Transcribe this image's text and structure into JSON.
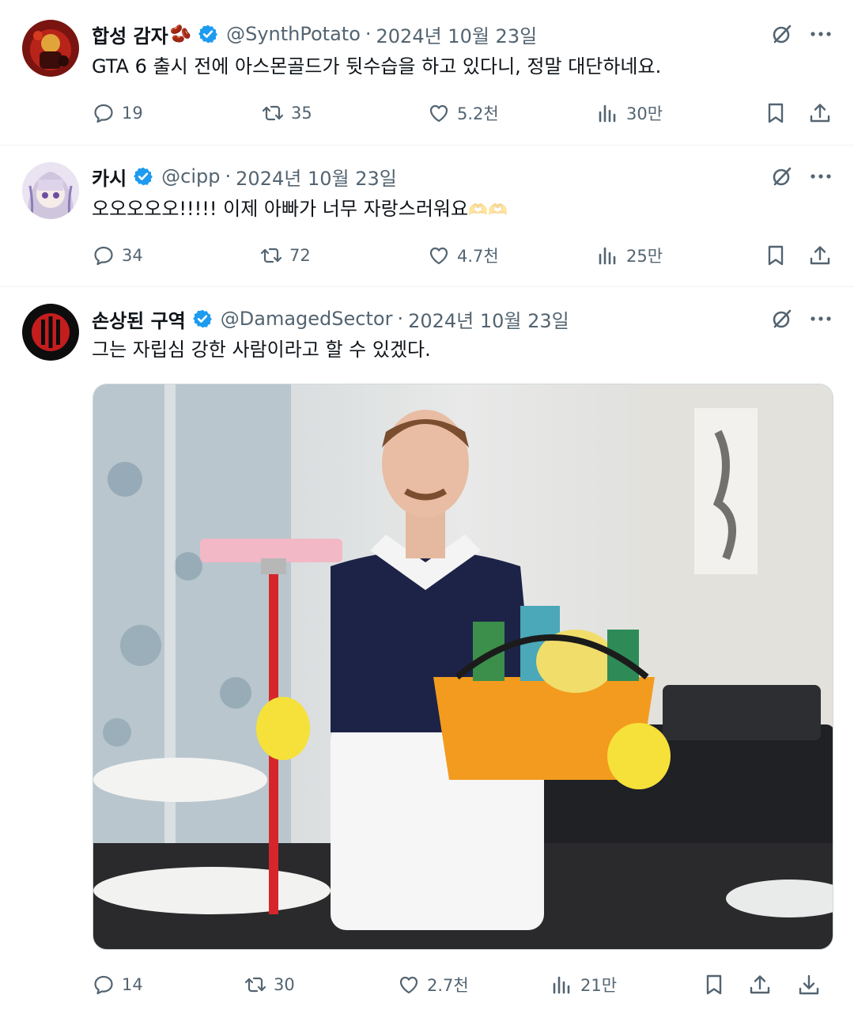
{
  "colors": {
    "text": "#0f1419",
    "muted": "#536471",
    "verified": "#1d9bf0",
    "divider": "#eff3f4"
  },
  "tweets": [
    {
      "name": "합성 감자",
      "name_emoji": "🫘",
      "handle": "@SynthPotato",
      "date": "2024년 10월 23일",
      "text": "GTA 6 출시 전에 아스몬골드가 뒷수습을 하고 있다니, 정말 대단하네요.",
      "replies": "19",
      "reposts": "35",
      "likes": "5.2천",
      "views": "30만"
    },
    {
      "name": "카시",
      "handle": "@cipp",
      "date": "2024년 10월 23일",
      "text": "오오오오오!!!!! 이제 아빠가 너무 자랑스러워요",
      "text_emoji": "🫶🫶",
      "replies": "34",
      "reposts": "72",
      "likes": "4.7천",
      "views": "25만"
    },
    {
      "name": "손상된 구역",
      "handle": "@DamagedSector",
      "date": "2024년 10월 23일",
      "text": "그는 자립심 강한 사람이라고 할 수 있겠다.",
      "replies": "14",
      "reposts": "30",
      "likes": "2.7천",
      "views": "21만"
    }
  ],
  "icons": {
    "grok": "grok-icon",
    "more": "more-dots-icon",
    "reply": "reply-icon",
    "repost": "repost-icon",
    "like": "heart-icon",
    "views": "views-chart-icon",
    "bookmark": "bookmark-icon",
    "share": "share-icon",
    "download": "download-icon"
  }
}
